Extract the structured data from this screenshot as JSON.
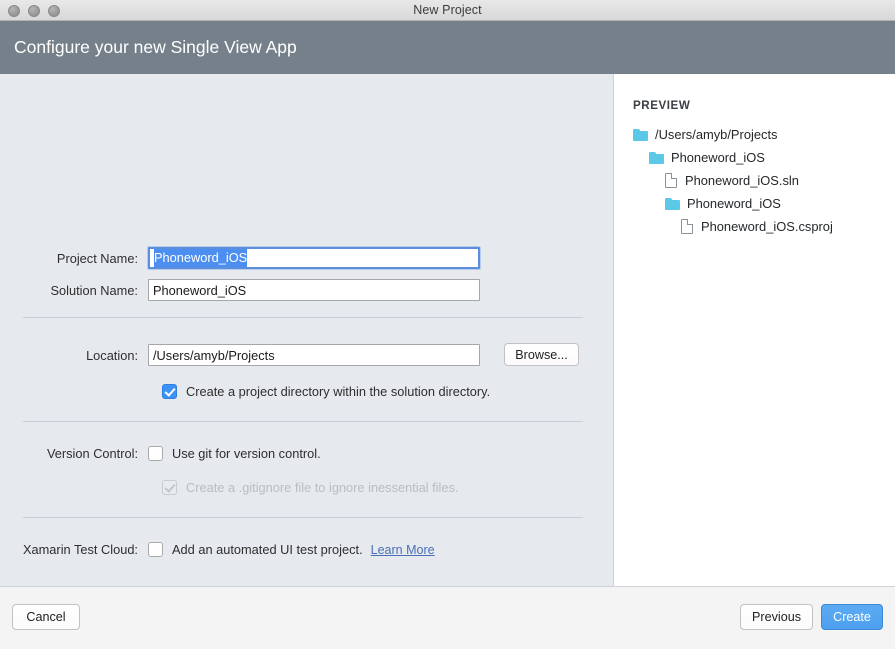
{
  "window": {
    "title": "New Project",
    "traffic_lights": [
      "close",
      "minimize",
      "zoom"
    ]
  },
  "header": {
    "title": "Configure your new Single View App"
  },
  "form": {
    "project_name": {
      "label": "Project Name:",
      "value": "Phoneword_iOS",
      "selected": true,
      "focused": true
    },
    "solution_name": {
      "label": "Solution Name:",
      "value": "Phoneword_iOS"
    },
    "location": {
      "label": "Location:",
      "value": "/Users/amyb/Projects",
      "browse_label": "Browse..."
    },
    "project_dir_checkbox": {
      "label": "Create a project directory within the solution directory.",
      "checked": true,
      "enabled": true
    },
    "version_control": {
      "label": "Version Control:",
      "use_git": {
        "label": "Use git for version control.",
        "checked": false,
        "enabled": true
      },
      "gitignore": {
        "label": "Create a .gitignore file to ignore inessential files.",
        "checked": true,
        "enabled": false
      }
    },
    "xamarin_test_cloud": {
      "label": "Xamarin Test Cloud:",
      "ui_test": {
        "label": "Add an automated UI test project.",
        "checked": false,
        "enabled": true
      },
      "learn_more": "Learn More"
    }
  },
  "preview": {
    "heading": "PREVIEW",
    "tree": [
      {
        "type": "folder",
        "name": "/Users/amyb/Projects",
        "depth": 0
      },
      {
        "type": "folder",
        "name": "Phoneword_iOS",
        "depth": 1
      },
      {
        "type": "file",
        "name": "Phoneword_iOS.sln",
        "depth": 2
      },
      {
        "type": "folder",
        "name": "Phoneword_iOS",
        "depth": 2
      },
      {
        "type": "file",
        "name": "Phoneword_iOS.csproj",
        "depth": 3
      }
    ]
  },
  "footer": {
    "cancel": "Cancel",
    "previous": "Previous",
    "create": "Create"
  },
  "colors": {
    "header_bg": "#76808b",
    "left_pane_bg": "#e6eaee",
    "accent_blue": "#4d9ff0",
    "selection_blue": "#4d8ff0",
    "folder_cyan": "#5bc8e8",
    "link_blue": "#4a6fb5"
  }
}
